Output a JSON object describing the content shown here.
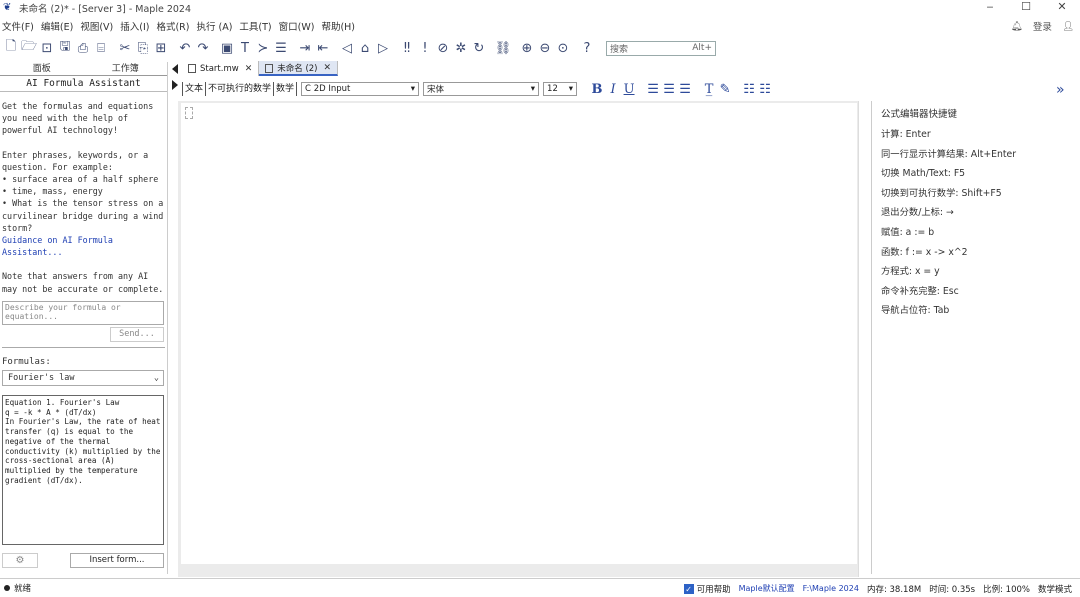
{
  "window": {
    "title": "未命名 (2)* - [Server 3] - Maple 2024",
    "app_icon": "maple-leaf-icon"
  },
  "menu": {
    "items": [
      "文件(F)",
      "编辑(E)",
      "视图(V)",
      "插入(I)",
      "格式(R)",
      "执行 (A)",
      "工具(T)",
      "窗口(W)",
      "帮助(H)"
    ],
    "right_label": "登录"
  },
  "toolbar": {
    "search_placeholder": "搜索",
    "search_shortcut": "Alt+"
  },
  "left_panel": {
    "tabs": [
      "面板",
      "工作簿"
    ],
    "header": "AI Formula Assistant",
    "intro": "Get the formulas and equations you need with the help of powerful AI technology!",
    "examples_intro": "Enter phrases, keywords, or a question. For example:",
    "examples": [
      "• surface area of a half sphere",
      "• time, mass, energy",
      "• What is the tensor stress on a curvilinear bridge during a wind storm?"
    ],
    "guidance_link": "Guidance on AI Formula",
    "guidance_link_cont": "Assistant...",
    "note": "Note that answers from any AI may not be accurate or complete.",
    "describe_placeholder": "Describe your formula or equation...",
    "send_label": "Send...",
    "formulas_label": "Formulas:",
    "formula_selected": "Fourier's law",
    "equation_lines": [
      "Equation 1. Fourier's Law",
      "q = -k * A * (dT/dx)",
      "In Fourier's Law, the rate of heat",
      "transfer (q) is equal to the",
      "negative of the thermal",
      "conductivity (k) multiplied by the",
      "cross-sectional area (A)",
      "multiplied by the temperature",
      "gradient (dT/dx)."
    ],
    "insert_label": "Insert form..."
  },
  "doc_tabs": [
    {
      "label": "Start.mw",
      "active": false
    },
    {
      "label": "未命名 (2)",
      "active": true
    }
  ],
  "context_bar": {
    "mode_text": "文本",
    "mode_nonexec": "不可执行的数学",
    "mode_math": "数学",
    "input_mode": "2D Input",
    "font": "宋体",
    "size": "12"
  },
  "shortcuts": {
    "title": "公式编辑器快捷键",
    "rows": [
      "计算: Enter",
      "同一行显示计算结果: Alt+Enter",
      "切换 Math/Text: F5",
      "切换到可执行数学: Shift+F5",
      "退出分数/上标: →",
      "赋值: a := b",
      "函数: f := x -> x^2",
      "方程式: x = y",
      "命令补充完整: Esc",
      "导航占位符: Tab"
    ]
  },
  "status": {
    "left": "就绪",
    "checkbox_label": "可用帮助",
    "link1": "Maple默认配置",
    "link2": "F:\\Maple 2024",
    "memory": "内存: 38.18M",
    "time": "时间: 0.35s",
    "zoom": "比例: 100%",
    "mode": "数学模式"
  }
}
